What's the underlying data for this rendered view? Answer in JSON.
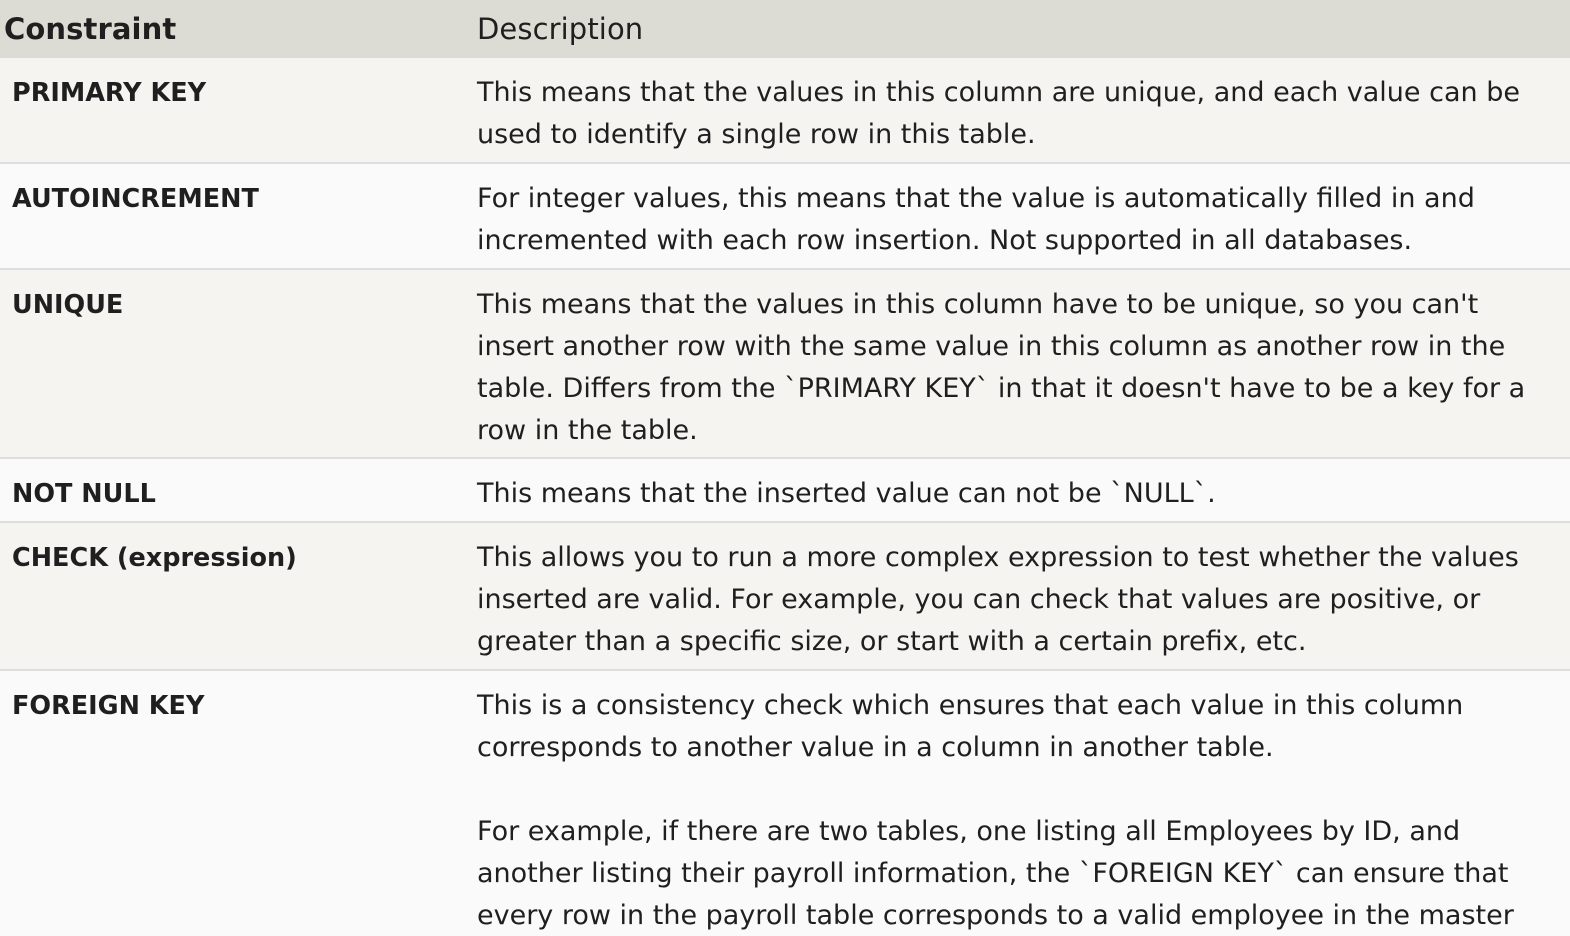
{
  "header": {
    "constraint": "Constraint",
    "description": "Description"
  },
  "rows": [
    {
      "name": "PRIMARY KEY",
      "description": [
        "This means that the values in this column are unique, and each value can be used to identify a single row in this table."
      ]
    },
    {
      "name": "AUTOINCREMENT",
      "description": [
        "For integer values, this means that the value is automatically filled in and incremented with each row insertion. Not supported in all databases."
      ]
    },
    {
      "name": "UNIQUE",
      "description": [
        "This means that the values in this column have to be unique, so you can't insert another row with the same value in this column as another row in the table. Differs from the `PRIMARY KEY` in that it doesn't have to be a key for a row in the table."
      ]
    },
    {
      "name": "NOT NULL",
      "description": [
        "This means that the inserted value can not be `NULL`."
      ]
    },
    {
      "name": "CHECK (expression)",
      "description": [
        "This allows you to run a more complex expression to test whether the values inserted are valid. For example, you can check that values are positive, or greater than a specific size, or start with a certain prefix, etc."
      ]
    },
    {
      "name": "FOREIGN KEY",
      "description": [
        "This is a consistency check which ensures that each value in this column corresponds to another value in a column in another table.",
        "For example, if there are two tables, one listing all Employees by ID, and another listing their payroll information, the `FOREIGN KEY` can ensure that every row in the payroll table corresponds to a valid employee in the master Employee list."
      ]
    }
  ]
}
